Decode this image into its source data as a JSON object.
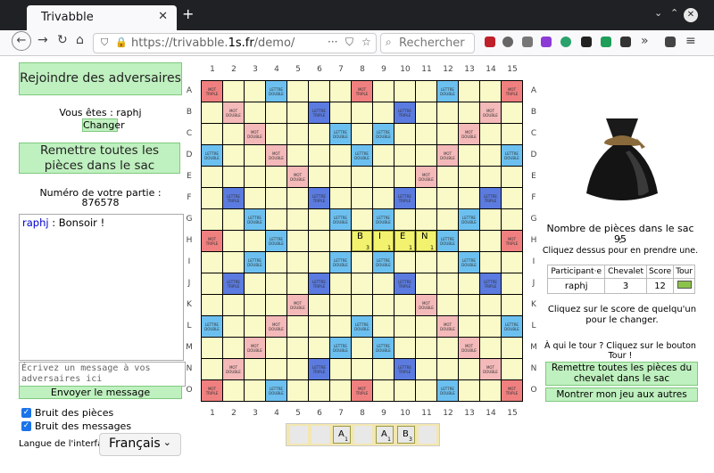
{
  "browser": {
    "tab_title": "Trivabble",
    "url_prefix": "https://trivabble.",
    "url_domain": "1s.fr",
    "url_path": "/demo/",
    "search_placeholder": "Rechercher"
  },
  "left": {
    "join_button": "Rejoindre des adversaires",
    "you_are_label": "Vous êtes : raphj",
    "change_button": "Changer",
    "reset_button": "Remettre toutes les pièces dans le sac",
    "game_number_label": "Numéro de votre partie :",
    "game_number": "876578",
    "chat_user": "raphj",
    "chat_text": " : Bonsoir !",
    "message_placeholder": "Écrivez un message à vos adversaires ici",
    "send_button": "Envoyer le message",
    "piece_noise_label": "Bruit des pièces",
    "message_noise_label": "Bruit des messages",
    "language_label": "Langue de l'interface :",
    "language_value": "Français"
  },
  "board": {
    "columns": [
      "1",
      "2",
      "3",
      "4",
      "5",
      "6",
      "7",
      "8",
      "9",
      "10",
      "11",
      "12",
      "13",
      "14",
      "15"
    ],
    "rows": [
      "A",
      "B",
      "C",
      "D",
      "E",
      "F",
      "G",
      "H",
      "I",
      "J",
      "K",
      "L",
      "M",
      "N",
      "O"
    ],
    "bonus_labels": {
      "tw": "MOT TRIPLE",
      "dw": "MOT DOUBLE",
      "tl": "LETTRE TRIPLE",
      "dl": "LETTRE DOUBLE"
    },
    "placed_tiles": [
      {
        "row": "H",
        "col": "8",
        "letter": "B",
        "value": "3"
      },
      {
        "row": "H",
        "col": "9",
        "letter": "I",
        "value": "1"
      },
      {
        "row": "H",
        "col": "10",
        "letter": "E",
        "value": "1"
      },
      {
        "row": "H",
        "col": "11",
        "letter": "N",
        "value": "1"
      }
    ]
  },
  "rack": {
    "tiles": [
      {
        "slot": 3,
        "letter": "A",
        "value": "1"
      },
      {
        "slot": 5,
        "letter": "A",
        "value": "1"
      },
      {
        "slot": 6,
        "letter": "B",
        "value": "3"
      }
    ]
  },
  "right": {
    "bag_count_label": "Nombre de pièces dans le sac :",
    "bag_count": "95",
    "bag_hint": "Cliquez dessus pour en prendre une.",
    "table_headers": [
      "Participant·e",
      "Chevalet",
      "Score",
      "Tour"
    ],
    "players": [
      {
        "name": "raphj",
        "rack": "3",
        "score": "12"
      }
    ],
    "score_hint": "Cliquez sur le score de quelqu'un pour le changer.",
    "turn_hint": "À qui le tour ? Cliquez sur le bouton Tour !",
    "return_rack_button": "Remettre toutes les pièces du chevalet dans le sac",
    "show_game_button": "Montrer mon jeu aux autres"
  }
}
